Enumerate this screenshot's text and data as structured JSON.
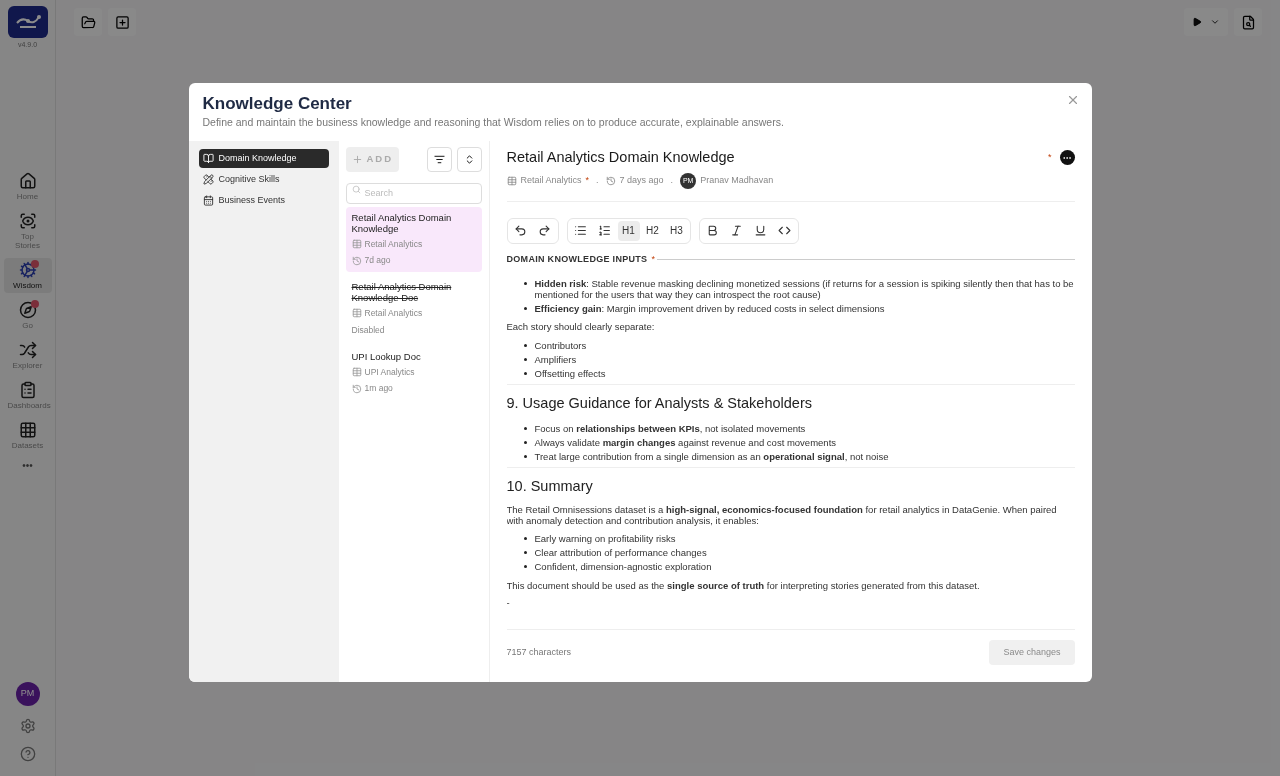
{
  "app": {
    "version": "v4.9.0",
    "nav": [
      {
        "label": "Home",
        "selected": false,
        "badge": false
      },
      {
        "label": "Top Stories",
        "selected": false,
        "badge": false
      },
      {
        "label": "Wisdom",
        "selected": true,
        "badge": true
      },
      {
        "label": "Go",
        "selected": false,
        "badge": true
      },
      {
        "label": "Explorer",
        "selected": false,
        "badge": false
      },
      {
        "label": "Dashboards",
        "selected": false,
        "badge": false
      },
      {
        "label": "Datasets",
        "selected": false,
        "badge": false
      }
    ],
    "more": "•••",
    "user_initials": "PM"
  },
  "dialog": {
    "title": "Knowledge Center",
    "subtitle": "Define and maintain the business knowledge and reasoning that Wisdom relies on to produce accurate, explainable answers.",
    "sections": [
      {
        "label": "Domain Knowledge",
        "selected": true
      },
      {
        "label": "Cognitive Skills",
        "selected": false
      },
      {
        "label": "Business Events",
        "selected": false
      }
    ],
    "add_button": "ADD",
    "search": {
      "placeholder": "Search"
    },
    "documents": [
      {
        "title": "Retail Analytics Domain Knowledge",
        "dataset": "Retail Analytics",
        "status": "7d ago",
        "disabled": false,
        "selected": true
      },
      {
        "title": "Retail Analytics Domain Knowledge Doc",
        "dataset": "Retail Analytics",
        "status": "Disabled",
        "disabled": true,
        "selected": false
      },
      {
        "title": "UPI Lookup Doc",
        "dataset": "UPI Analytics",
        "status": "1m ago",
        "disabled": false,
        "selected": false
      }
    ],
    "editor": {
      "title": "Retail Analytics Domain Knowledge",
      "title_marker": "*",
      "dataset": "Retail Analytics",
      "dataset_marker": "*",
      "separator": ".",
      "updated": "7 days ago",
      "author_initials": "PM",
      "author": "Pranav Madhavan",
      "toolbar": [
        {
          "kind": "undo",
          "selected": false
        },
        {
          "kind": "redo",
          "selected": false
        },
        {
          "kind": "bullets",
          "selected": false
        },
        {
          "kind": "numbers",
          "selected": false
        },
        {
          "kind": "text",
          "label": "H1",
          "selected": true
        },
        {
          "kind": "text",
          "label": "H2",
          "selected": false
        },
        {
          "kind": "text",
          "label": "H3",
          "selected": false
        },
        {
          "kind": "bold",
          "selected": false
        },
        {
          "kind": "italic",
          "selected": false
        },
        {
          "kind": "underline",
          "selected": false
        },
        {
          "kind": "code",
          "selected": false
        }
      ],
      "section_label": "DOMAIN KNOWLEDGE INPUTS",
      "section_marker": "*",
      "blocks": [
        {
          "kind": "list",
          "items": [
            "**Hidden risk**: Stable revenue masking declining monetized sessions (if returns for a session is spiking silently then that has to be mentioned for the users that way they can introspect the root cause)",
            "**Efficiency gain**: Margin improvement driven by reduced costs in select dimensions"
          ]
        },
        {
          "kind": "paragraph",
          "text": "Each story should clearly separate:"
        },
        {
          "kind": "list",
          "items": [
            "Contributors",
            "Amplifiers",
            "Offsetting effects"
          ]
        },
        {
          "kind": "rule"
        },
        {
          "kind": "heading",
          "text": "9. Usage Guidance for Analysts & Stakeholders"
        },
        {
          "kind": "list",
          "items": [
            "Focus on **relationships between KPIs**, not isolated movements",
            "Always validate **margin changes** against revenue and cost movements",
            "Treat large contribution from a single dimension as an **operational signal**, not noise"
          ]
        },
        {
          "kind": "rule"
        },
        {
          "kind": "heading",
          "text": "10. Summary"
        },
        {
          "kind": "paragraph",
          "text": "The Retail Omnisessions dataset is a **high-signal, economics-focused foundation** for retail analytics in DataGenie. When paired with anomaly detection and contribution analysis, it enables:"
        },
        {
          "kind": "list",
          "items": [
            "Early warning on profitability risks",
            "Clear attribution of performance changes",
            "Confident, dimension-agnostic exploration"
          ]
        },
        {
          "kind": "paragraph",
          "text": "This document should be used as the **single source of truth** for interpreting stories generated from this dataset."
        },
        {
          "kind": "paragraph",
          "text": "-"
        }
      ],
      "char_count": "7157 characters",
      "save_button": {
        "label": "Save changes",
        "disabled": true
      }
    }
  }
}
